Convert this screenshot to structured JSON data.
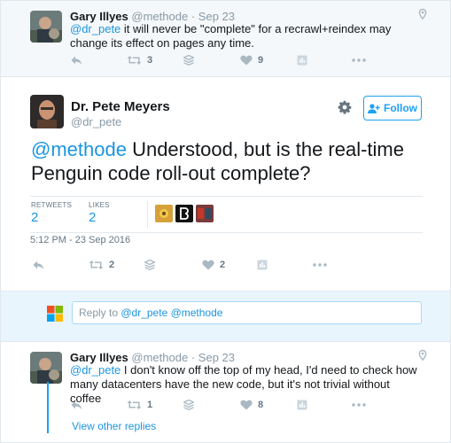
{
  "parent_tweet": {
    "author_name": "Gary Illyes",
    "author_handle": "@methode",
    "separator": "·",
    "date": "Sep 23",
    "mention": "@dr_pete",
    "text": " it will never be \"complete\" for a recrawl+reindex may change its effect on pages any time.",
    "retweet_count": "3",
    "like_count": "9"
  },
  "main_tweet": {
    "author_name": "Dr. Pete Meyers",
    "author_handle": "@dr_pete",
    "follow_label": "Follow",
    "mention": "@methode",
    "text": " Understood, but is the real-time Penguin code roll-out complete?",
    "retweets_label": "RETWEETS",
    "retweets_value": "2",
    "likes_label": "LIKES",
    "likes_value": "2",
    "timestamp": "5:12 PM - 23 Sep 2016",
    "action_retweet_count": "2",
    "action_like_count": "2"
  },
  "reply_box": {
    "prefix": "Reply to ",
    "mentions": "@dr_pete @methode"
  },
  "child_tweet": {
    "author_name": "Gary Illyes",
    "author_handle": "@methode",
    "separator": "·",
    "date": "Sep 23",
    "mention": "@dr_pete",
    "text": " I don't know off the top of my head, I'd need to check how many datacenters have the new code, but it's not trivial without coffee",
    "retweet_count": "1",
    "like_count": "8",
    "view_replies_label": "View other replies"
  },
  "colors": {
    "accent": "#1da1f2",
    "link": "#1b95e0",
    "muted": "#8899a6",
    "reply_bg": "#e8f5fd"
  }
}
